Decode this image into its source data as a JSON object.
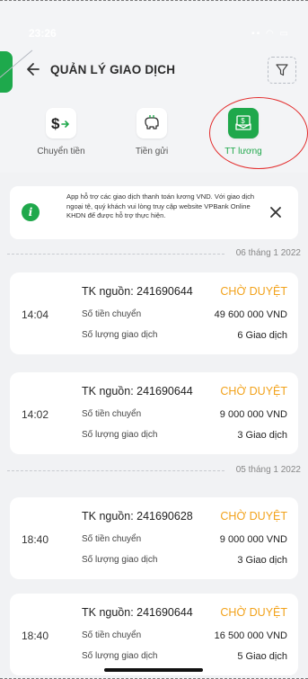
{
  "status_bar": {
    "time": "23:26",
    "icons": "▪▪ ◠ ▭"
  },
  "header": {
    "title": "QUẢN LÝ GIAO DỊCH"
  },
  "tabs": [
    {
      "label": "Chuyển tiền",
      "icon": "dollar-transfer-icon",
      "active": false
    },
    {
      "label": "Tiền gửi",
      "icon": "piggy-bank-icon",
      "active": false
    },
    {
      "label": "TT lương",
      "icon": "payroll-icon",
      "active": true
    }
  ],
  "notice": {
    "text": "App hỗ trợ các giao dịch thanh toán lương VND. Với giao dịch ngoại tệ, quý khách vui lòng truy cập website VPBank Online KHDN để được hỗ trợ thực hiện.",
    "icon": "info-icon"
  },
  "groups": [
    {
      "date": "06 tháng 1 2022",
      "transactions": [
        {
          "time": "14:04",
          "source": "TK nguồn: 241690644",
          "status": "CHỜ DUYỆT",
          "amount_label": "Số tiền chuyển",
          "amount": "49 600 000 VND",
          "count_label": "Số lượng giao dịch",
          "count": "6 Giao dịch"
        },
        {
          "time": "14:02",
          "source": "TK nguồn: 241690644",
          "status": "CHỜ DUYỆT",
          "amount_label": "Số tiền chuyển",
          "amount": "9 000 000 VND",
          "count_label": "Số lượng giao dịch",
          "count": "3 Giao dịch"
        }
      ]
    },
    {
      "date": "05 tháng 1 2022",
      "transactions": [
        {
          "time": "18:40",
          "source": "TK nguồn: 241690628",
          "status": "CHỜ DUYỆT",
          "amount_label": "Số tiền chuyển",
          "amount": "9 000 000 VND",
          "count_label": "Số lượng giao dịch",
          "count": "3 Giao dịch"
        },
        {
          "time": "18:40",
          "source": "TK nguồn: 241690644",
          "status": "CHỜ DUYỆT",
          "amount_label": "Số tiền chuyển",
          "amount": "16 500 000 VND",
          "count_label": "Số lượng giao dịch",
          "count": "5 Giao dịch"
        }
      ]
    }
  ],
  "colors": {
    "accent": "#1fa84b",
    "pending": "#f2a21b",
    "annotation": "#e32b2b"
  }
}
